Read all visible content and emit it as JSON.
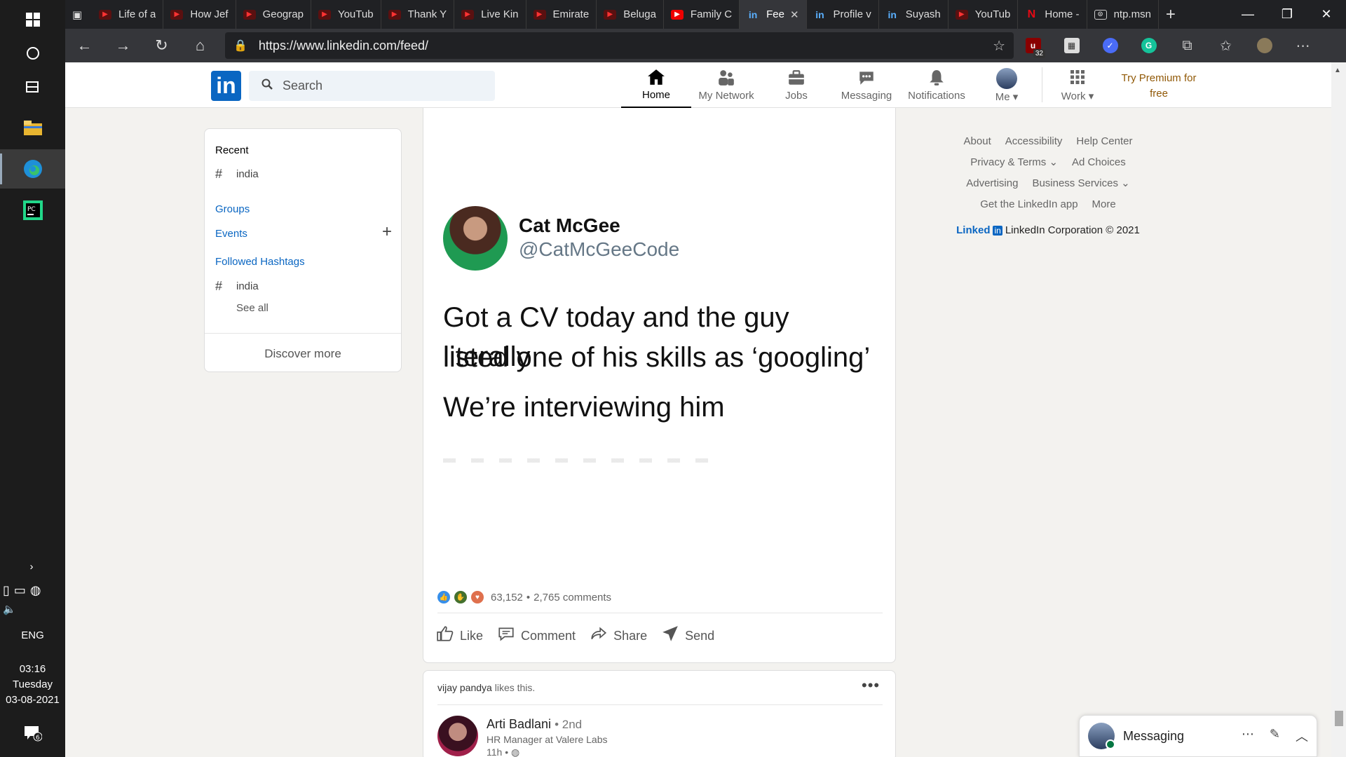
{
  "taskbar": {
    "lang": "ENG",
    "time": "03:16",
    "day": "Tuesday",
    "date": "03-08-2021",
    "notif_count": "6"
  },
  "browser": {
    "tabs": [
      {
        "label": "Life of a",
        "icon": "youtube-icon"
      },
      {
        "label": "How Jef",
        "icon": "youtube-icon"
      },
      {
        "label": "Geograp",
        "icon": "youtube-icon"
      },
      {
        "label": "YouTub",
        "icon": "youtube-icon"
      },
      {
        "label": "Thank Y",
        "icon": "youtube-icon"
      },
      {
        "label": "Live Kin",
        "icon": "youtube-icon"
      },
      {
        "label": "Emirate",
        "icon": "youtube-icon"
      },
      {
        "label": "Beluga",
        "icon": "youtube-icon"
      },
      {
        "label": "Family C",
        "icon": "youtube-icon"
      },
      {
        "label": "Fee",
        "icon": "linkedin-icon",
        "active": true
      },
      {
        "label": "Profile v",
        "icon": "linkedin-icon"
      },
      {
        "label": "Suyash",
        "icon": "linkedin-icon"
      },
      {
        "label": "YouTub",
        "icon": "youtube-icon"
      },
      {
        "label": "Home -",
        "icon": "netflix-icon"
      },
      {
        "label": "ntp.msn",
        "icon": "page-icon"
      }
    ],
    "url": "https://www.linkedin.com/feed/",
    "ext_badge": "32"
  },
  "linkedin": {
    "logo": "in",
    "search_placeholder": "Search",
    "nav": [
      {
        "label": "Home",
        "icon": "home-icon"
      },
      {
        "label": "My Network",
        "icon": "network-icon"
      },
      {
        "label": "Jobs",
        "icon": "briefcase-icon"
      },
      {
        "label": "Messaging",
        "icon": "chat-icon"
      },
      {
        "label": "Notifications",
        "icon": "bell-icon"
      }
    ],
    "me_label": "Me",
    "work_label": "Work",
    "premium_line1": "Try Premium for",
    "premium_line2": "free"
  },
  "left_card": {
    "recent_title": "Recent",
    "recent_item": "india",
    "groups": "Groups",
    "events": "Events",
    "followed_hashtags": "Followed Hashtags",
    "hashtag_item": "india",
    "see_all": "See all",
    "discover_more": "Discover more"
  },
  "post": {
    "tweet_name": "Cat McGee",
    "tweet_handle": "@CatMcGeeCode",
    "tweet_line1": "Got a CV today and the guy literally",
    "tweet_line2": "listed one of his skills as ‘googling’",
    "tweet_line3": "We’re interviewing him",
    "reaction_count": "63,152",
    "comment_count": "2,765 comments",
    "actions": {
      "like": "Like",
      "comment": "Comment",
      "share": "Share",
      "send": "Send"
    }
  },
  "post2": {
    "liker": "vijay pandya",
    "liker_suffix": "likes this.",
    "author_name": "Arti Badlani",
    "author_degree": "• 2nd",
    "author_title": "HR Manager at Valere Labs",
    "time": "11h •"
  },
  "footer": {
    "about": "About",
    "accessibility": "Accessibility",
    "help_center": "Help Center",
    "privacy_terms": "Privacy & Terms",
    "ad_choices": "Ad Choices",
    "advertising": "Advertising",
    "business_services": "Business Services",
    "get_app": "Get the LinkedIn app",
    "more": "More",
    "brand_text": "Linked",
    "brand_in": "in",
    "corp": "LinkedIn Corporation © 2021"
  },
  "messaging": {
    "label": "Messaging"
  },
  "colors": {
    "linkedin_blue": "#0a66c2",
    "premium_gold": "#915907",
    "feed_bg": "#f3f2ef"
  }
}
